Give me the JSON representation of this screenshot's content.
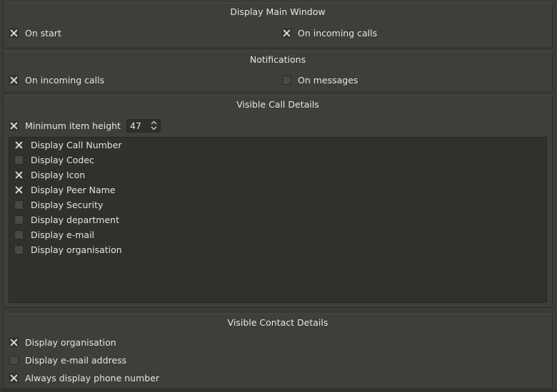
{
  "main_window": {
    "title": "Display Main Window",
    "on_start": {
      "label": "On start",
      "checked": true
    },
    "on_incoming_calls": {
      "label": "On incoming calls",
      "checked": true
    }
  },
  "notifications": {
    "title": "Notifications",
    "on_incoming_calls": {
      "label": "On incoming calls",
      "checked": true
    },
    "on_messages": {
      "label": "On messages",
      "checked": false
    }
  },
  "call_details": {
    "title": "Visible Call Details",
    "min_height": {
      "label": "Minimum item height",
      "checked": true,
      "value": "47"
    },
    "items": [
      {
        "label": "Display Call Number",
        "checked": true
      },
      {
        "label": "Display Codec",
        "checked": false
      },
      {
        "label": "Display Icon",
        "checked": true
      },
      {
        "label": "Display Peer Name",
        "checked": true
      },
      {
        "label": "Display Security",
        "checked": false
      },
      {
        "label": "Display department",
        "checked": false
      },
      {
        "label": "Display e-mail",
        "checked": false
      },
      {
        "label": "Display organisation",
        "checked": false
      }
    ]
  },
  "contact_details": {
    "title": "Visible Contact Details",
    "display_organisation": {
      "label": "Display organisation",
      "checked": true
    },
    "display_email": {
      "label": "Display e-mail address",
      "checked": false
    },
    "always_phone": {
      "label": "Always display phone number",
      "checked": true
    }
  },
  "colors": {
    "background": "#3c3b37",
    "text": "#e6e4df"
  }
}
